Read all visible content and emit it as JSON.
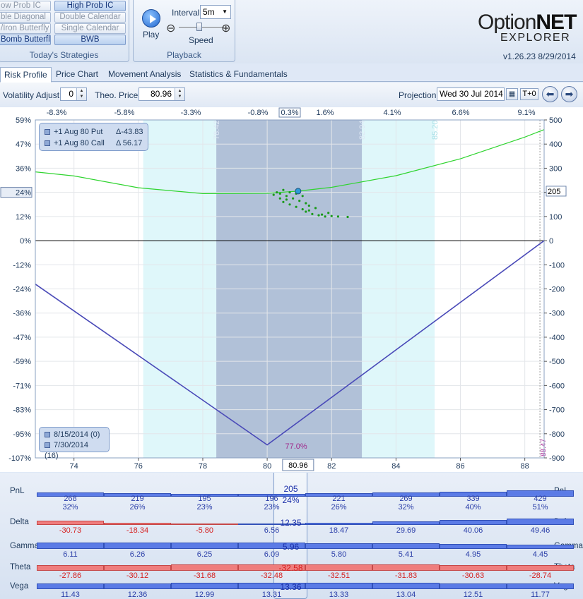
{
  "ribbon": {
    "strategies": {
      "title": "Today's Strategies",
      "left_items": [
        "ow Prob IC",
        "ble Diagonal",
        "/Iron Butterfly",
        "Bomb Butterfly"
      ],
      "right_items": [
        "High Prob IC",
        "Double Calendar",
        "Single Calendar",
        "BWB"
      ]
    },
    "playback": {
      "title": "Playback",
      "play_label": "Play",
      "interval_label": "Interval",
      "interval_value": "5m",
      "speed_label": "Speed",
      "speed_minus": "⊖",
      "speed_plus": "⊕"
    },
    "brand": {
      "name_part1": "Option",
      "name_part2": "NET",
      "sub": "EXPLORER",
      "version": "v1.26.23  8/29/2014"
    }
  },
  "tabs": [
    "Risk Profile",
    "Price Chart",
    "Movement Analysis",
    "Statistics & Fundamentals"
  ],
  "controls": {
    "volatility_label": "Volatility Adjust",
    "volatility_value": "0",
    "theo_label": "Theo. Price",
    "theo_value": "80.96",
    "projection_label": "Projection",
    "projection_value": "Wed 30 Jul 2014",
    "t0_label": "T+0"
  },
  "chart_data": {
    "type": "line",
    "top_axis_ticks": [
      "-8.3%",
      "-5.8%",
      "-3.3%",
      "-0.8%",
      "0.3%",
      "1.6%",
      "4.1%",
      "6.6%",
      "9.1%"
    ],
    "left_axis_ticks": [
      "59%",
      "47%",
      "36%",
      "24%",
      "12%",
      "0%",
      "-12%",
      "-24%",
      "-36%",
      "-47%",
      "-59%",
      "-71%",
      "-83%",
      "-95%",
      "-107%"
    ],
    "left_axis_highlight": "24%",
    "right_axis_ticks": [
      "500",
      "400",
      "300",
      "200",
      "100",
      "0",
      "-100",
      "-200",
      "-300",
      "-400",
      "-500",
      "-600",
      "-700",
      "-800",
      "-900"
    ],
    "right_axis_highlight": "205",
    "x_ticks": [
      74,
      76,
      78,
      80,
      82,
      84,
      86,
      88
    ],
    "x_highlight": "80.96",
    "xlim": [
      72.8,
      88.6
    ],
    "ylim": [
      -900,
      500
    ],
    "zones": {
      "inner": [
        78.42,
        82.94
      ],
      "outer": [
        76.15,
        85.2
      ],
      "inner_labels": [
        "78.42",
        "82.94"
      ],
      "outer_label": "85.20",
      "marker": 88.47,
      "marker_label": "88.47"
    },
    "probability_label": "77.0%",
    "series": [
      {
        "name": "8/15/2014 (0)",
        "color": "#4a4ab8",
        "x": [
          72.8,
          80.0,
          88.6
        ],
        "y": [
          -180,
          -846,
          0
        ]
      },
      {
        "name": "7/30/2014 (16)",
        "color": "#2fd42f",
        "x": [
          72.8,
          74,
          76,
          78,
          80,
          80.96,
          82,
          84,
          86,
          88,
          88.6
        ],
        "y": [
          285,
          268,
          219,
          195,
          196,
          205,
          221,
          269,
          339,
          429,
          460
        ]
      }
    ],
    "current_point": {
      "x": 80.96,
      "y": 205
    },
    "legend_positions": [
      {
        "label": "+1 Aug 80 Put",
        "delta": "Δ-43.83"
      },
      {
        "label": "+1 Aug 80 Call",
        "delta": "Δ 56.17"
      }
    ]
  },
  "greeks": {
    "rows": [
      {
        "label": "PnL",
        "values": [
          "268",
          "219",
          "195",
          "196",
          "205",
          "221",
          "269",
          "339",
          "429"
        ],
        "pcts": [
          "32%",
          "26%",
          "23%",
          "23%",
          "24%",
          "26%",
          "32%",
          "40%",
          "51%"
        ]
      },
      {
        "label": "Delta",
        "values": [
          "-30.73",
          "-18.34",
          "-5.80",
          "6.56",
          "12.35",
          "18.47",
          "29.69",
          "40.06",
          "49.46"
        ]
      },
      {
        "label": "Gamma",
        "values": [
          "6.11",
          "6.26",
          "6.25",
          "6.09",
          "5.96",
          "5.80",
          "5.41",
          "4.95",
          "4.45"
        ]
      },
      {
        "label": "Theta",
        "values": [
          "-27.86",
          "-30.12",
          "-31.68",
          "-32.48",
          "-32.58",
          "-32.51",
          "-31.83",
          "-30.63",
          "-28.74"
        ]
      },
      {
        "label": "Vega",
        "values": [
          "11.43",
          "12.36",
          "12.99",
          "13.31",
          "13.36",
          "13.33",
          "13.04",
          "12.51",
          "11.77"
        ]
      }
    ]
  }
}
